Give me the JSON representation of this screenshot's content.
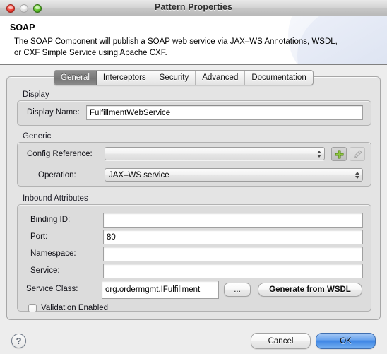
{
  "window": {
    "title": "Pattern Properties",
    "traffic_lights": [
      "close",
      "minimize",
      "zoom"
    ]
  },
  "header": {
    "title": "SOAP",
    "description": "The SOAP Component will publish a SOAP web service via JAX–WS Annotations, WSDL, or CXF Simple Service using Apache CXF."
  },
  "tabs": [
    {
      "label": "General",
      "selected": true
    },
    {
      "label": "Interceptors",
      "selected": false
    },
    {
      "label": "Security",
      "selected": false
    },
    {
      "label": "Advanced",
      "selected": false
    },
    {
      "label": "Documentation",
      "selected": false
    }
  ],
  "sections": {
    "display": {
      "label": "Display",
      "display_name_label": "Display Name:",
      "display_name_value": "FulfillmentWebService",
      "display_name_placeholder": ""
    },
    "generic": {
      "label": "Generic",
      "config_reference_label": "Config Reference:",
      "config_reference_value": "",
      "config_reference_placeholder": "",
      "add_button_icon": "plus-icon",
      "edit_button_icon": "pencil-icon",
      "operation_label": "Operation:",
      "operation_value": "JAX–WS service",
      "operation_options": [
        "JAX–WS service"
      ]
    },
    "inbound": {
      "label": "Inbound Attributes",
      "binding_id_label": "Binding ID:",
      "binding_id_value": "",
      "port_label": "Port:",
      "port_value": "80",
      "namespace_label": "Namespace:",
      "namespace_value": "",
      "service_label": "Service:",
      "service_value": "",
      "service_class_label": "Service Class:",
      "service_class_value": "org.ordermgmt.IFulfillment",
      "browse_button_label": "...",
      "generate_button_label": "Generate from WSDL",
      "validation_label": "Validation Enabled",
      "validation_checked": false
    }
  },
  "footer": {
    "help_label": "?",
    "cancel_label": "Cancel",
    "ok_label": "OK"
  },
  "colors": {
    "accent_default_button": "#3d85e4",
    "tab_selected": "#7c7c7c",
    "add_icon_green": "#79b51f",
    "window_background": "#ededed"
  }
}
